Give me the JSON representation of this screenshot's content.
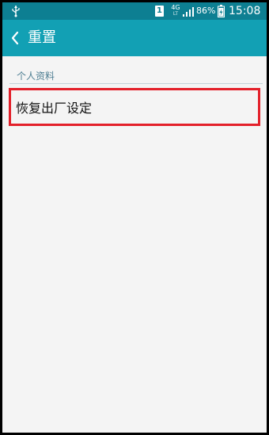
{
  "status_bar": {
    "sim_slot": "1",
    "network_type": "4G",
    "network_sub": "LT",
    "battery_percent": "86%",
    "time": "15:08",
    "icons": [
      "usb-icon",
      "sim-icon",
      "signal-icon",
      "battery-charging-icon"
    ]
  },
  "app_bar": {
    "title": "重置",
    "back_icon": "chevron-left-icon"
  },
  "section": {
    "title": "个人资料"
  },
  "items": [
    {
      "label": "恢复出厂设定"
    }
  ],
  "colors": {
    "status_bar": "#0d7f92",
    "app_bar": "#12a0b4",
    "background": "#f4f4f4",
    "highlight": "#e3202a",
    "section_text": "#4f7f93"
  }
}
